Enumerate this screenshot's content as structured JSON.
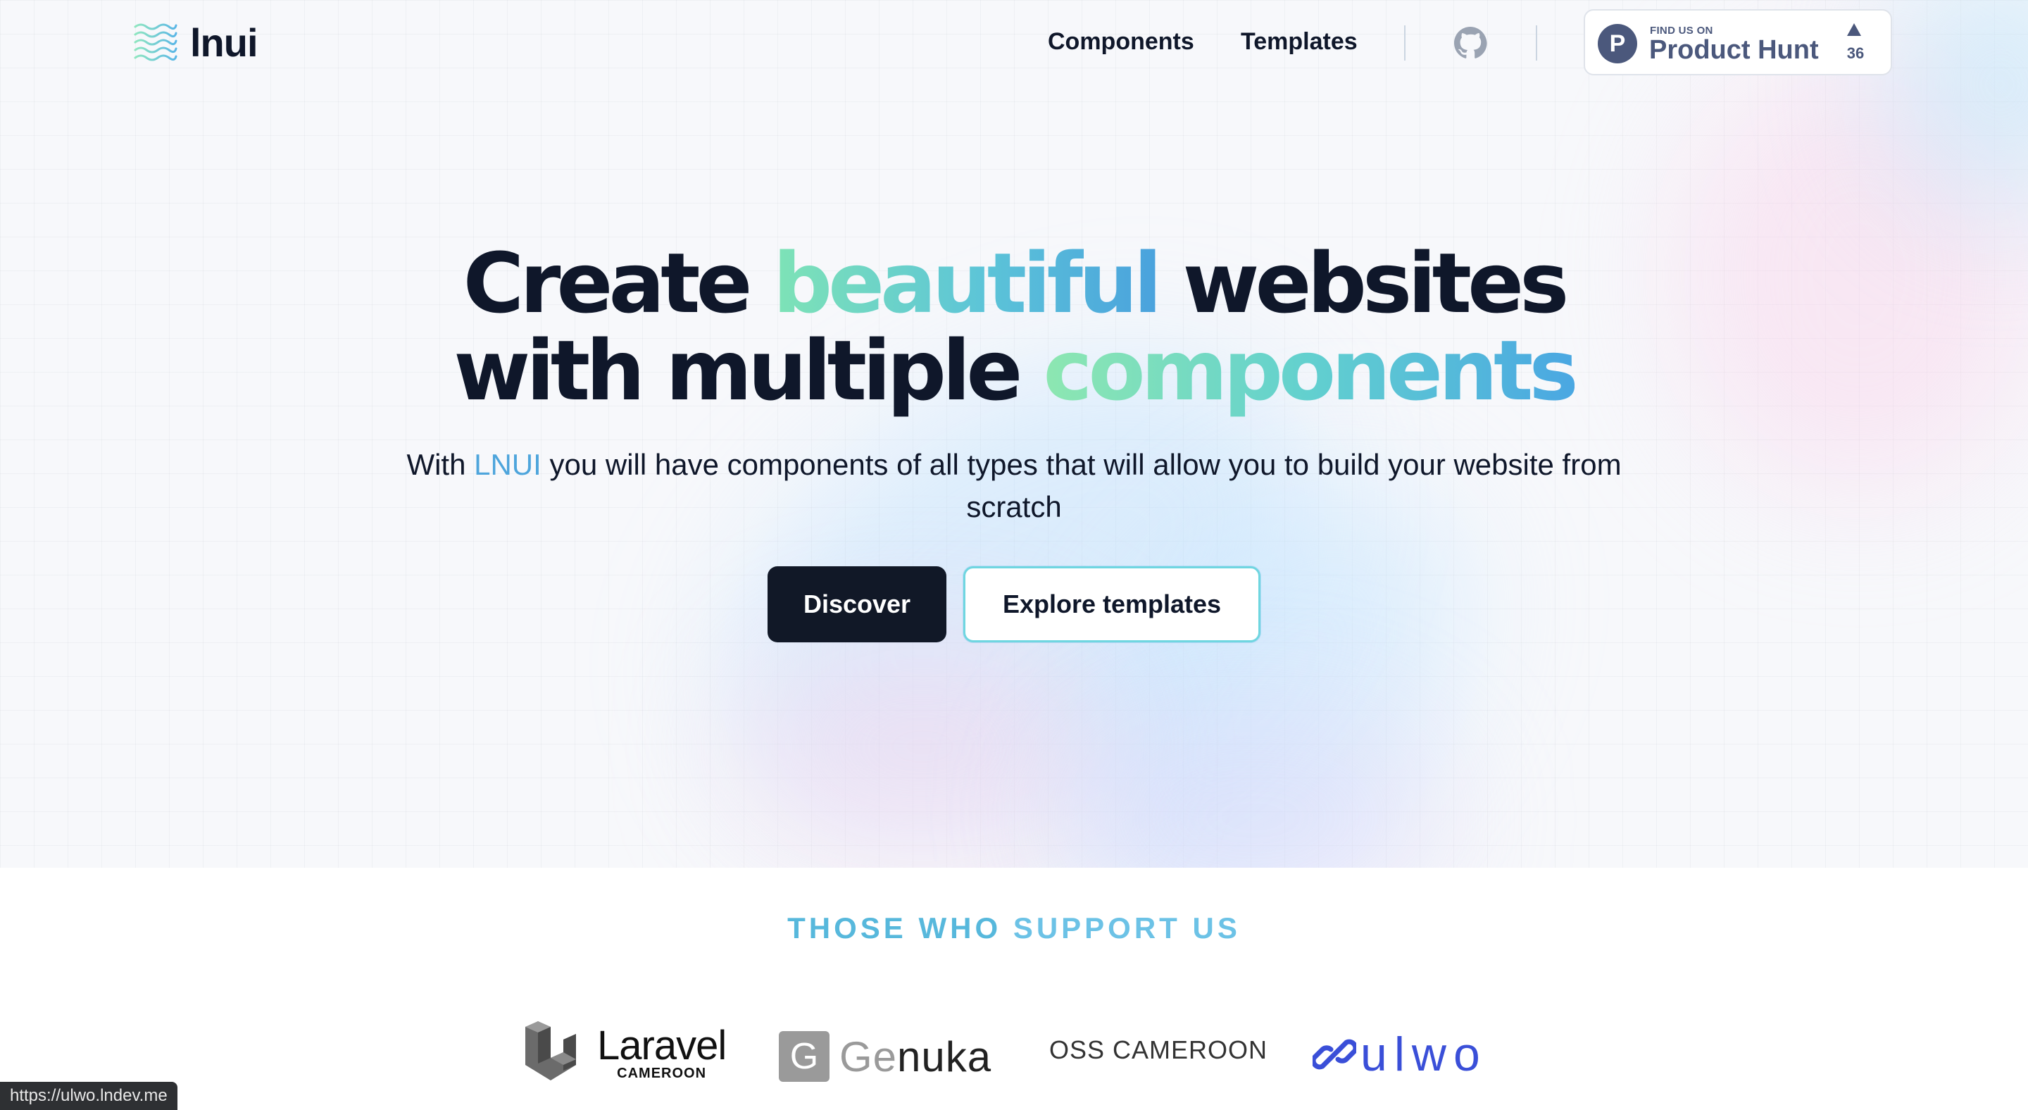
{
  "nav": {
    "logo_text": "lnui",
    "links": [
      {
        "label": "Components"
      },
      {
        "label": "Templates"
      }
    ],
    "product_hunt": {
      "small_label": "FIND US ON",
      "big_label": "Product Hunt",
      "logo_letter": "P",
      "upvotes": "36"
    }
  },
  "hero": {
    "headline": {
      "line1_a": "Create ",
      "line1_gradient": "beautiful",
      "line1_b": " websites",
      "line2_a": "with multiple ",
      "line2_gradient": "components"
    },
    "subtitle": {
      "prefix": "With ",
      "brand": "LNUI",
      "suffix": " you will have components of all types that will allow you to build your website from scratch"
    },
    "buttons": {
      "primary": "Discover",
      "secondary": "Explore templates"
    }
  },
  "support": {
    "title_a": "THOSE WHO ",
    "title_b": "SUPPORT US",
    "sponsors": {
      "laravel_name": "Laravel",
      "laravel_sub": "CAMEROON",
      "genuka_letter": "G",
      "genuka_name_a": "Ge",
      "genuka_name_b": "nuka",
      "oss": "OSS CAMEROON",
      "ulwo": "ulwo"
    }
  },
  "status_bar": {
    "url": "https://ulwo.lndev.me"
  },
  "colors": {
    "ink": "#0f172a",
    "brand_blue": "#4ea5dc",
    "gradient_green": "#7ee3b6",
    "product_hunt": "#4b587c",
    "ulwo_blue": "#3a4fd8"
  }
}
